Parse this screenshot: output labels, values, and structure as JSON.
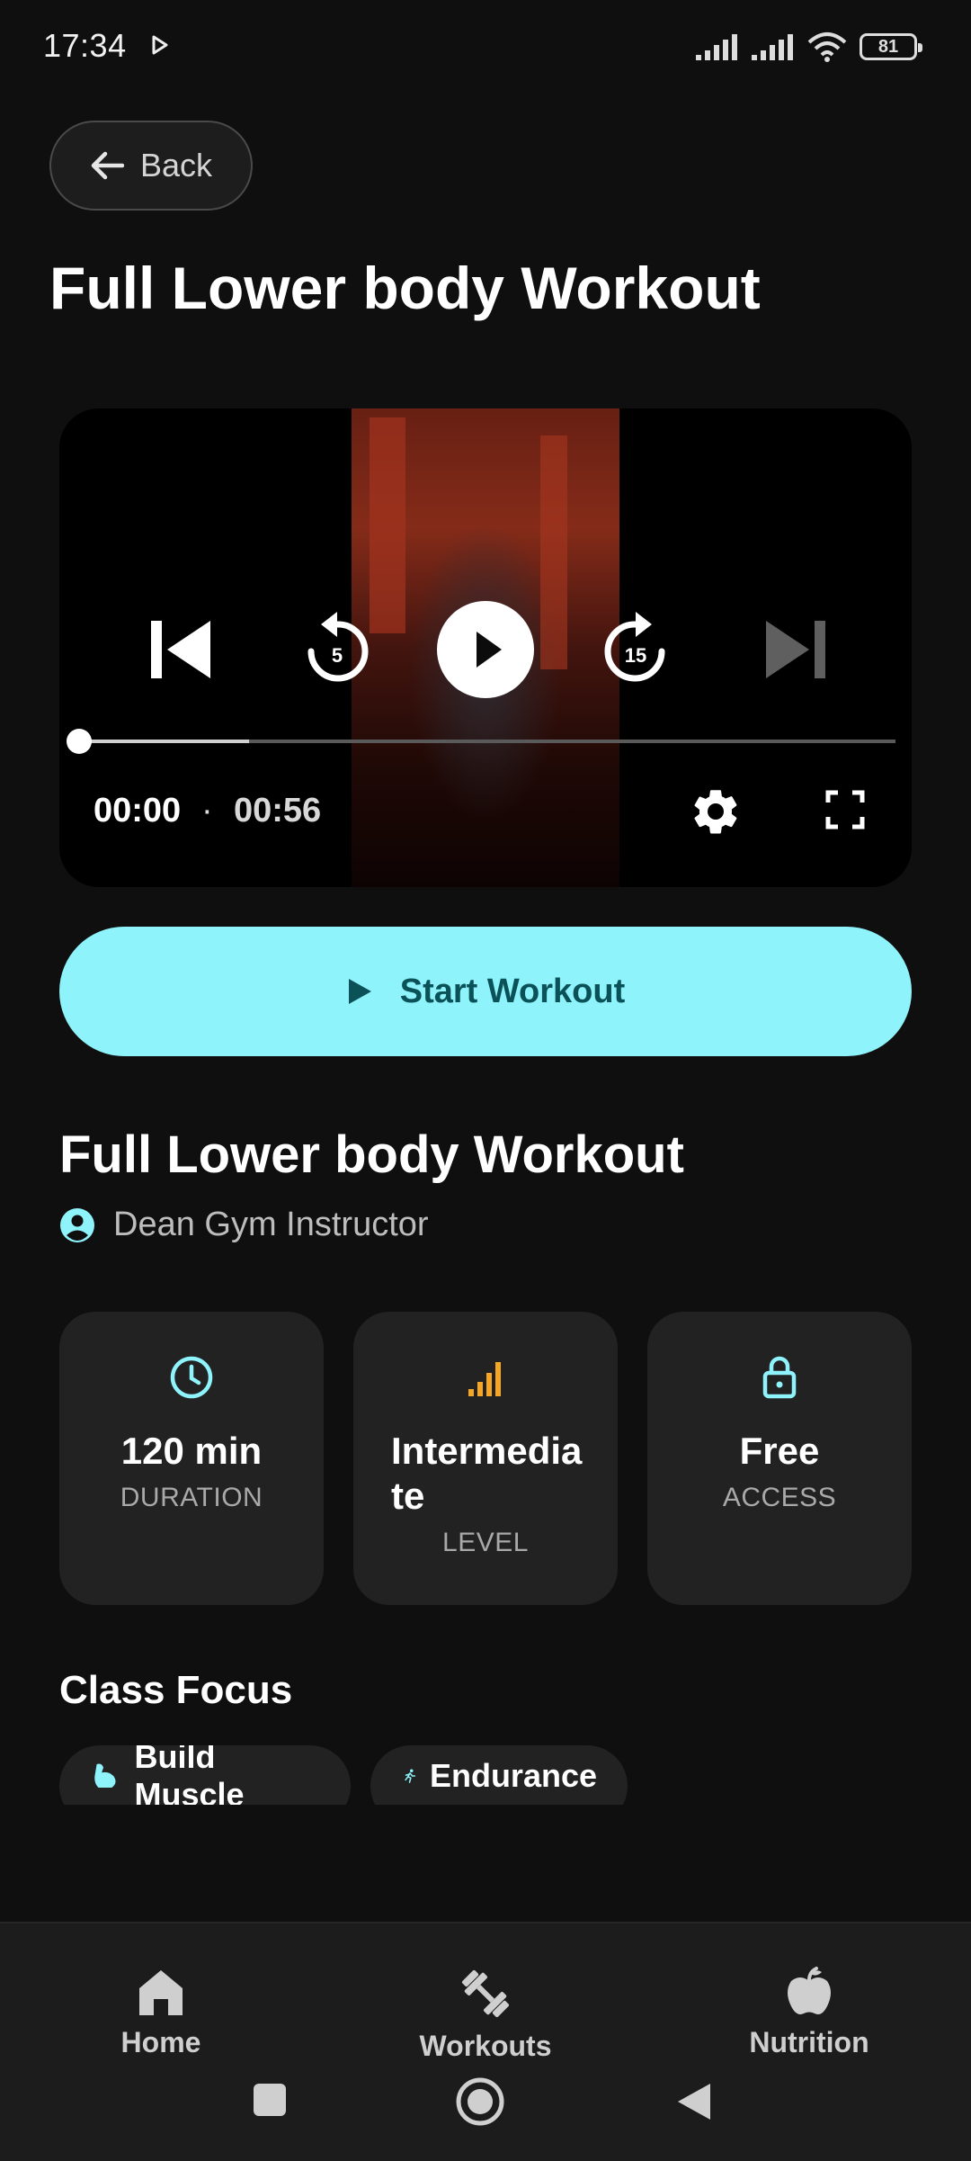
{
  "status_bar": {
    "time": "17:34",
    "battery": "81"
  },
  "header": {
    "back_label": "Back",
    "title": "Full Lower body Workout"
  },
  "video": {
    "current_time": "00:00",
    "separator": "·",
    "total_time": "00:56",
    "rewind_seconds": "5",
    "forward_seconds": "15",
    "buffered_fraction": 0.21
  },
  "start_button": {
    "label": "Start Workout"
  },
  "details": {
    "title": "Full Lower body Workout",
    "instructor": "Dean Gym Instructor"
  },
  "stats": [
    {
      "value": "120 min",
      "label": "DURATION",
      "icon": "clock-icon"
    },
    {
      "value": "Intermedia te",
      "label": "LEVEL",
      "icon": "signal-bars-icon"
    },
    {
      "value": "Free",
      "label": "ACCESS",
      "icon": "unlock-icon"
    }
  ],
  "class_focus": {
    "title": "Class Focus",
    "chips": [
      {
        "label": "Build Muscle",
        "icon": "bicep-icon"
      },
      {
        "label": "Endurance",
        "icon": "runner-icon"
      }
    ]
  },
  "bottom_nav": [
    {
      "label": "Home",
      "icon": "home-icon"
    },
    {
      "label": "Workouts",
      "icon": "dumbbell-icon"
    },
    {
      "label": "Nutrition",
      "icon": "apple-icon"
    }
  ],
  "colors": {
    "background": "#0f0f0f",
    "accent": "#8ef3fb",
    "accent_text": "#0b5258",
    "level_icon": "#f5a623",
    "card": "#222222"
  }
}
